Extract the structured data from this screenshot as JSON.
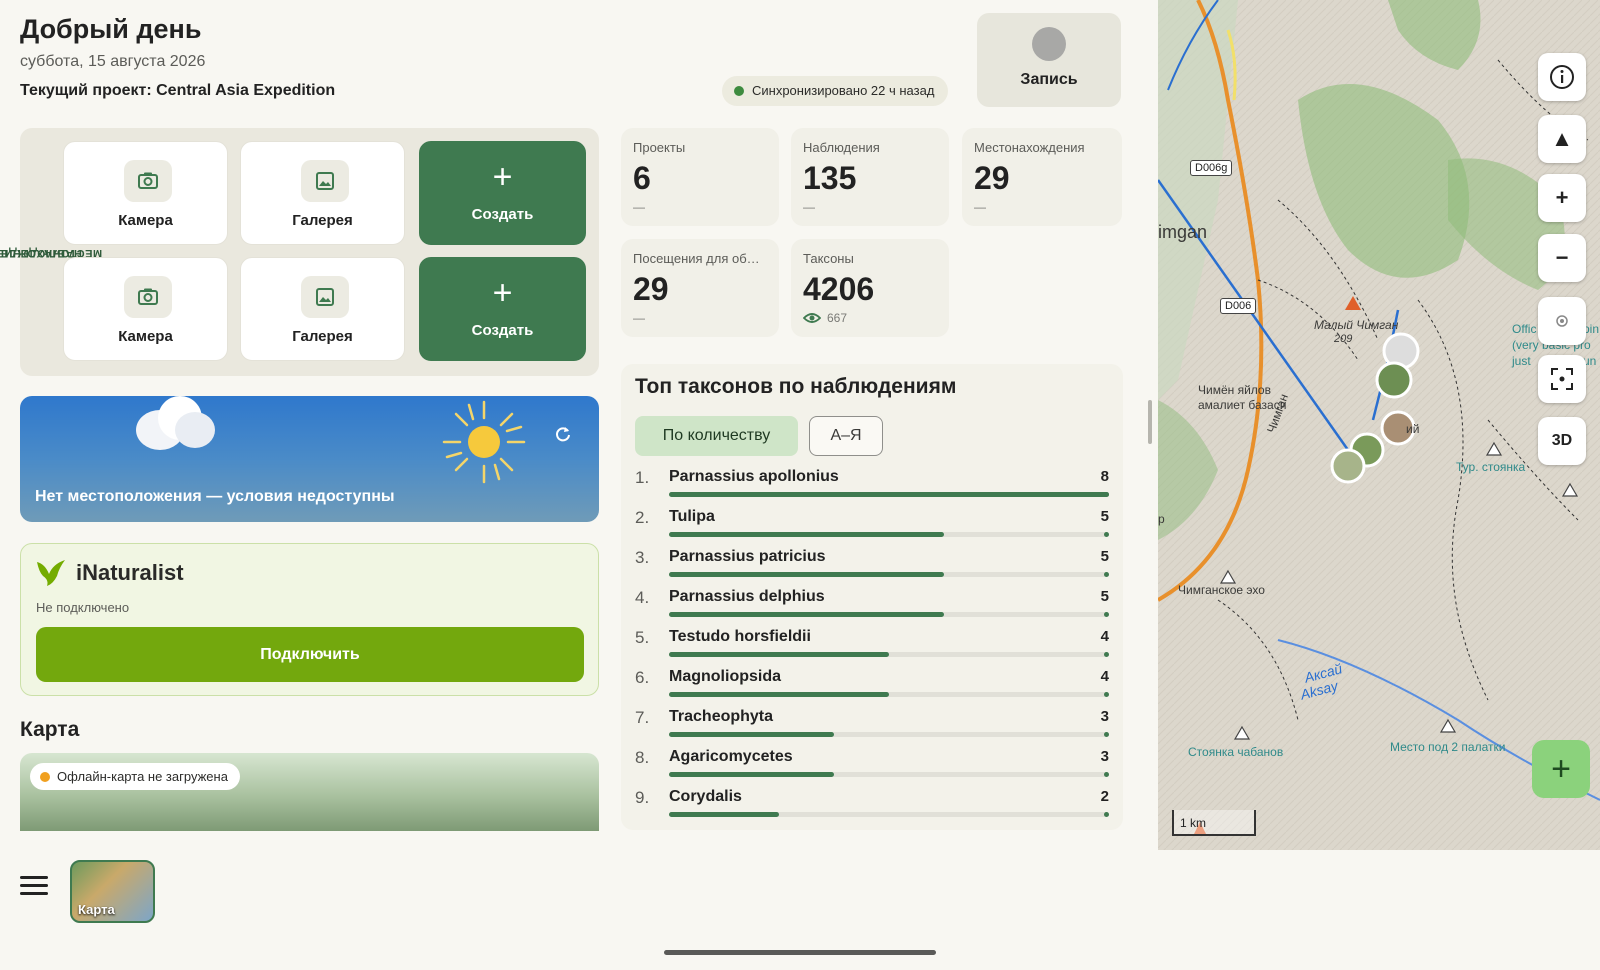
{
  "header": {
    "greeting": "Добрый день",
    "date": "суббота, 15 августа 2026",
    "project": "Текущий проект: Central Asia Expedition",
    "sync_status": "Синхронизировано 22 ч назад",
    "record_label": "Запись"
  },
  "quick_actions": {
    "rows": [
      {
        "section_label": "НАБЛЮДЕНИЕ",
        "camera": "Камера",
        "gallery": "Галерея",
        "create": "Создать"
      },
      {
        "section_label": "МЕСТОНАХОЖДЕНИЕ",
        "camera": "Камера",
        "gallery": "Галерея",
        "create": "Создать"
      }
    ],
    "colors": {
      "create_bg": "#3f7a50"
    }
  },
  "stats": [
    {
      "title": "Проекты",
      "value": "6",
      "sub": "—"
    },
    {
      "title": "Наблюдения",
      "value": "135",
      "sub": "—"
    },
    {
      "title": "Местонахождения",
      "value": "29",
      "sub": "—"
    },
    {
      "title": "Посещения для об…",
      "value": "29",
      "sub": "—"
    },
    {
      "title": "Таксоны",
      "value": "4206",
      "sub": "667",
      "sub_icon": "eye-icon"
    }
  ],
  "weather": {
    "message": "Нет местоположения — условия недоступны",
    "icons": [
      "cloud-icon",
      "sun-icon",
      "refresh-icon"
    ]
  },
  "inaturalist": {
    "name": "iNaturalist",
    "status": "Не подключено",
    "connect_label": "Подключить",
    "colors": {
      "button": "#73a80d"
    }
  },
  "map_section": {
    "title": "Карта",
    "offline_status": "Офлайн-карта не загружена"
  },
  "top_taxa": {
    "title": "Топ таксонов по наблюдениям",
    "sort_by_count": "По количеству",
    "sort_alpha": "А–Я",
    "max": 8,
    "items": [
      {
        "rank": "1.",
        "name": "Parnassius apollonius",
        "count": 8
      },
      {
        "rank": "2.",
        "name": "Tulipa",
        "count": 5
      },
      {
        "rank": "3.",
        "name": "Parnassius patricius",
        "count": 5
      },
      {
        "rank": "4.",
        "name": "Parnassius delphius",
        "count": 5
      },
      {
        "rank": "5.",
        "name": "Testudo horsfieldii",
        "count": 4
      },
      {
        "rank": "6.",
        "name": "Magnoliopsida",
        "count": 4
      },
      {
        "rank": "7.",
        "name": "Tracheophyta",
        "count": 3
      },
      {
        "rank": "8.",
        "name": "Agaricomycetes",
        "count": 3
      },
      {
        "rank": "9.",
        "name": "Corydalis",
        "count": 2
      }
    ]
  },
  "bottom_bar": {
    "map_thumb_label": "Карта"
  },
  "map": {
    "labels": {
      "road1": "D006g",
      "road2": "D006",
      "town": "imgan",
      "peak": "Малый Чимган",
      "peak_elev": "209",
      "camp1": "Чимён яйлов",
      "camp1b": "амалиет базаси",
      "river_vert": "Чимган",
      "echo": "Чимганское эхо",
      "river": "Аксай",
      "river_lat": "Aksay",
      "tur_camp": "Тур. стоянка",
      "shepherd": "Стоянка чабанов",
      "tents": "Место под 2 палатки",
      "side_note1": "Offic",
      "side_note2": "(very basic pro",
      "side_note3": "just",
      "side_note4": "pin",
      "side_note5": "un",
      "side_note6": "ий",
      "edge_label": "p"
    },
    "scale": "1 km",
    "controls": {
      "mode_3d": "3D"
    },
    "colors": {
      "road": "#e8902c",
      "path": "#2a6fd0",
      "forest": "#8fbc7a"
    }
  }
}
